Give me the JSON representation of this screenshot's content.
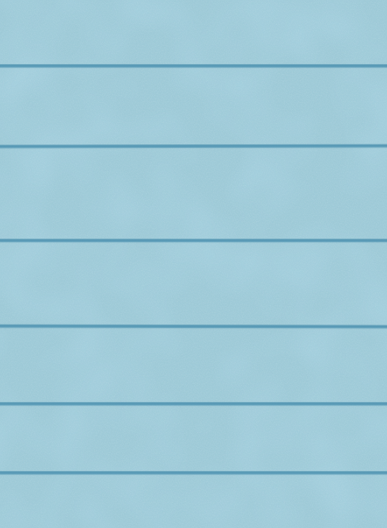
{
  "surface": {
    "description_kind": "textured-board",
    "colors": {
      "base": "#9dc9d6",
      "speckle": "#7fb6cb",
      "highlight": "#b3d5df",
      "groove": "#4e92b0"
    },
    "groove_count": 6
  }
}
